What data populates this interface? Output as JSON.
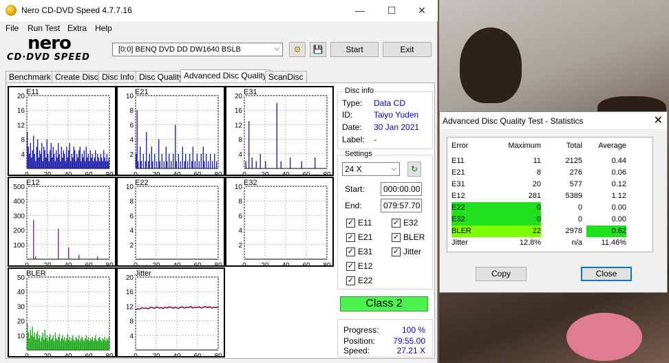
{
  "app": {
    "title": "Nero CD-DVD Speed 4.7.7.16",
    "logo_top": "nero",
    "logo_bottom": "CD·DVD SPEED"
  },
  "window_controls": {
    "minimize": "—",
    "maximize": "☐",
    "close": "✕"
  },
  "menu": [
    "File",
    "Run Test",
    "Extra",
    "Help"
  ],
  "toolbar": {
    "drive": "[0:0]   BENQ DVD DD DW1640 BSLB",
    "start": "Start",
    "exit": "Exit"
  },
  "tabs": [
    "Benchmark",
    "Create Disc",
    "Disc Info",
    "Disc Quality",
    "Advanced Disc Quality",
    "ScanDisc"
  ],
  "active_tab": "Advanced Disc Quality",
  "disc_info": {
    "title": "Disc info",
    "type_label": "Type:",
    "type": "Data CD",
    "id_label": "ID:",
    "id": "Taiyo Yuden",
    "date_label": "Date:",
    "date": "30 Jan 2021",
    "label_label": "Label:",
    "label": "-"
  },
  "settings": {
    "title": "Settings",
    "speed": "24 X",
    "start_label": "Start:",
    "start": "000:00.00",
    "end_label": "End:",
    "end": "079:57.70",
    "checks": [
      {
        "label": "E11",
        "checked": true
      },
      {
        "label": "E32",
        "checked": true
      },
      {
        "label": "E21",
        "checked": true
      },
      {
        "label": "BLER",
        "checked": true
      },
      {
        "label": "E31",
        "checked": true
      },
      {
        "label": "Jitter",
        "checked": true
      },
      {
        "label": "E12",
        "checked": true
      },
      {
        "label": "E22",
        "checked": true
      }
    ]
  },
  "class_label": "Class 2",
  "progress": {
    "progress_label": "Progress:",
    "progress": "100 %",
    "position_label": "Position:",
    "position": "79:55.00",
    "speed_label": "Speed:",
    "speed": "27.21 X"
  },
  "colors": {
    "e_series": "#0000a0",
    "e12": "#800080",
    "bler": "#00a000",
    "jitter": "#800040",
    "class_bg": "#4ef24e",
    "highlight_green": "#20e020",
    "highlight_lime": "#80ff00"
  },
  "chart_data": [
    {
      "type": "bar",
      "title": "E11",
      "x": [
        0,
        80
      ],
      "xticks": [
        "0",
        "20",
        "40",
        "60",
        "80"
      ],
      "yticks": [
        "4",
        "8",
        "12",
        "16",
        "20"
      ],
      "ylim": [
        0,
        20
      ],
      "color": "#0000a0",
      "values": [
        10,
        6,
        4,
        7,
        3,
        5,
        9,
        4,
        2,
        6,
        8,
        3,
        5,
        4,
        7,
        2,
        6,
        5,
        3,
        8,
        4,
        2,
        5,
        7,
        3,
        6,
        4,
        2,
        5,
        3,
        7,
        4,
        2,
        6,
        3,
        5,
        4,
        2,
        6,
        3,
        5,
        7,
        2,
        4,
        3,
        6,
        5,
        2,
        4,
        3,
        5,
        6,
        2,
        4,
        3,
        5,
        2,
        6,
        3,
        4,
        2,
        5,
        3,
        4,
        2,
        3,
        5,
        2,
        4,
        3,
        2,
        4,
        3,
        2,
        5,
        3,
        2,
        4,
        2,
        3
      ]
    },
    {
      "type": "bar",
      "title": "E21",
      "x": [
        0,
        80
      ],
      "xticks": [
        "0",
        "20",
        "40",
        "60",
        "80"
      ],
      "yticks": [
        "2",
        "4",
        "6",
        "8",
        "10"
      ],
      "ylim": [
        0,
        10
      ],
      "color": "#0000a0",
      "values": [
        2,
        8,
        1,
        0,
        3,
        1,
        0,
        2,
        0,
        1,
        5,
        0,
        1,
        2,
        0,
        3,
        1,
        0,
        2,
        0,
        1,
        0,
        4,
        1,
        0,
        2,
        0,
        1,
        0,
        3,
        1,
        0,
        2,
        0,
        1,
        0,
        2,
        0,
        6,
        1,
        0,
        2,
        0,
        1,
        0,
        3,
        0,
        1,
        2,
        0,
        1,
        0,
        2,
        0,
        1,
        3,
        0,
        1,
        0,
        2,
        0,
        1,
        0,
        2,
        0,
        3,
        1,
        0,
        2,
        0,
        1,
        0,
        2,
        0,
        1,
        0,
        2,
        0,
        1,
        0
      ]
    },
    {
      "type": "bar",
      "title": "E31",
      "x": [
        0,
        80
      ],
      "xticks": [
        "0",
        "20",
        "40",
        "60",
        "80"
      ],
      "yticks": [
        "4",
        "8",
        "12",
        "16",
        "20"
      ],
      "ylim": [
        0,
        20
      ],
      "color": "#0000a0",
      "values": [
        0,
        2,
        0,
        0,
        13,
        0,
        0,
        3,
        0,
        0,
        0,
        2,
        0,
        0,
        0,
        4,
        0,
        0,
        0,
        0,
        2,
        0,
        0,
        0,
        0,
        0,
        0,
        0,
        0,
        0,
        0,
        18,
        0,
        0,
        0,
        2,
        0,
        0,
        0,
        0,
        0,
        0,
        0,
        0,
        3,
        0,
        0,
        0,
        0,
        0,
        0,
        0,
        0,
        0,
        0,
        2,
        0,
        0,
        0,
        0,
        0,
        0,
        0,
        0,
        0,
        0,
        0,
        0,
        3,
        0,
        0,
        0,
        0,
        0,
        0,
        0,
        0,
        0,
        0,
        0
      ]
    },
    {
      "type": "bar",
      "title": "E12",
      "x": [
        0,
        80
      ],
      "xticks": [
        "0",
        "20",
        "40",
        "60",
        "80"
      ],
      "yticks": [
        "100",
        "200",
        "300",
        "400",
        "500"
      ],
      "ylim": [
        0,
        500
      ],
      "color": "#800080",
      "values": [
        0,
        0,
        0,
        0,
        0,
        0,
        270,
        0,
        20,
        0,
        0,
        0,
        0,
        0,
        0,
        0,
        0,
        0,
        0,
        0,
        0,
        0,
        0,
        0,
        0,
        0,
        0,
        0,
        0,
        0,
        210,
        0,
        0,
        0,
        0,
        0,
        0,
        0,
        0,
        0,
        80,
        0,
        0,
        0,
        0,
        0,
        0,
        0,
        0,
        0,
        30,
        0,
        0,
        0,
        0,
        0,
        0,
        0,
        0,
        0,
        0,
        0,
        0,
        0,
        0,
        0,
        0,
        0,
        20,
        0,
        0,
        0,
        0,
        0,
        0,
        0,
        0,
        0,
        0,
        0
      ]
    },
    {
      "type": "bar",
      "title": "E22",
      "x": [
        0,
        80
      ],
      "xticks": [
        "0",
        "20",
        "40",
        "60",
        "80"
      ],
      "yticks": [
        "2",
        "4",
        "6",
        "8",
        "10"
      ],
      "ylim": [
        0,
        10
      ],
      "color": "#0000a0",
      "values": []
    },
    {
      "type": "bar",
      "title": "E32",
      "x": [
        0,
        80
      ],
      "xticks": [
        "0",
        "20",
        "40",
        "60",
        "80"
      ],
      "yticks": [
        "2",
        "4",
        "6",
        "8",
        "10"
      ],
      "ylim": [
        0,
        10
      ],
      "color": "#0000a0",
      "values": []
    },
    {
      "type": "bar",
      "title": "BLER",
      "x": [
        0,
        80
      ],
      "xticks": [
        "0",
        "20",
        "40",
        "60",
        "80"
      ],
      "yticks": [
        "10",
        "20",
        "30",
        "40",
        "50"
      ],
      "ylim": [
        0,
        50
      ],
      "color": "#00a000",
      "values": [
        18,
        12,
        8,
        14,
        10,
        16,
        9,
        12,
        7,
        11,
        13,
        8,
        10,
        6,
        9,
        12,
        7,
        14,
        8,
        10,
        6,
        9,
        11,
        7,
        8,
        10,
        6,
        12,
        8,
        7,
        9,
        11,
        6,
        8,
        10,
        7,
        9,
        6,
        8,
        11,
        7,
        9,
        6,
        8,
        10,
        7,
        6,
        9,
        8,
        7,
        10,
        6,
        8,
        9,
        7,
        6,
        8,
        10,
        7,
        9,
        6,
        8,
        7,
        9,
        6,
        8,
        10,
        7,
        6,
        8,
        9,
        7,
        6,
        8,
        7,
        9,
        6,
        8,
        7,
        9
      ]
    },
    {
      "type": "line",
      "title": "Jitter",
      "x": [
        0,
        80
      ],
      "xticks": [
        "0",
        "20",
        "40",
        "60",
        "80"
      ],
      "yticks": [
        "4",
        "8",
        "12",
        "16",
        "20"
      ],
      "ylim": [
        0,
        20
      ],
      "color": "#800040",
      "values": [
        11.0,
        11.3,
        11.2,
        11.6,
        11.4,
        11.5,
        11.3,
        11.7,
        11.6,
        11.4,
        11.8,
        11.5,
        11.6,
        11.4,
        11.7,
        11.5,
        11.8,
        11.6,
        11.5,
        11.7,
        11.4,
        11.6,
        11.8,
        11.5,
        11.7,
        11.6,
        11.9,
        11.5,
        11.7,
        11.6,
        11.8,
        11.5,
        11.7,
        11.9,
        11.6,
        11.8,
        11.5,
        11.7,
        11.6,
        11.8
      ]
    }
  ],
  "stats": {
    "title": "Advanced Disc Quality Test - Statistics",
    "close_icon": "✕",
    "headers": [
      "Error",
      "Maximum",
      "Total",
      "Average"
    ],
    "rows": [
      {
        "error": "E11",
        "max": "11",
        "total": "2125",
        "avg": "0.44",
        "hl": ""
      },
      {
        "error": "E21",
        "max": "8",
        "total": "276",
        "avg": "0.06",
        "hl": ""
      },
      {
        "error": "E31",
        "max": "20",
        "total": "577",
        "avg": "0.12",
        "hl": ""
      },
      {
        "error": "E12",
        "max": "281",
        "total": "5389",
        "avg": "1.12",
        "hl": ""
      },
      {
        "error": "E22",
        "max": "0",
        "total": "0",
        "avg": "0.00",
        "hl": "green"
      },
      {
        "error": "E32",
        "max": "0",
        "total": "0",
        "avg": "0.00",
        "hl": "green"
      },
      {
        "error": "BLER",
        "max": "22",
        "total": "2978",
        "avg": "0.62",
        "hl": "lime"
      },
      {
        "error": "Jitter",
        "max": "12.8%",
        "total": "n/a",
        "avg": "11.46%",
        "hl": ""
      }
    ],
    "copy": "Copy",
    "close": "Close"
  }
}
